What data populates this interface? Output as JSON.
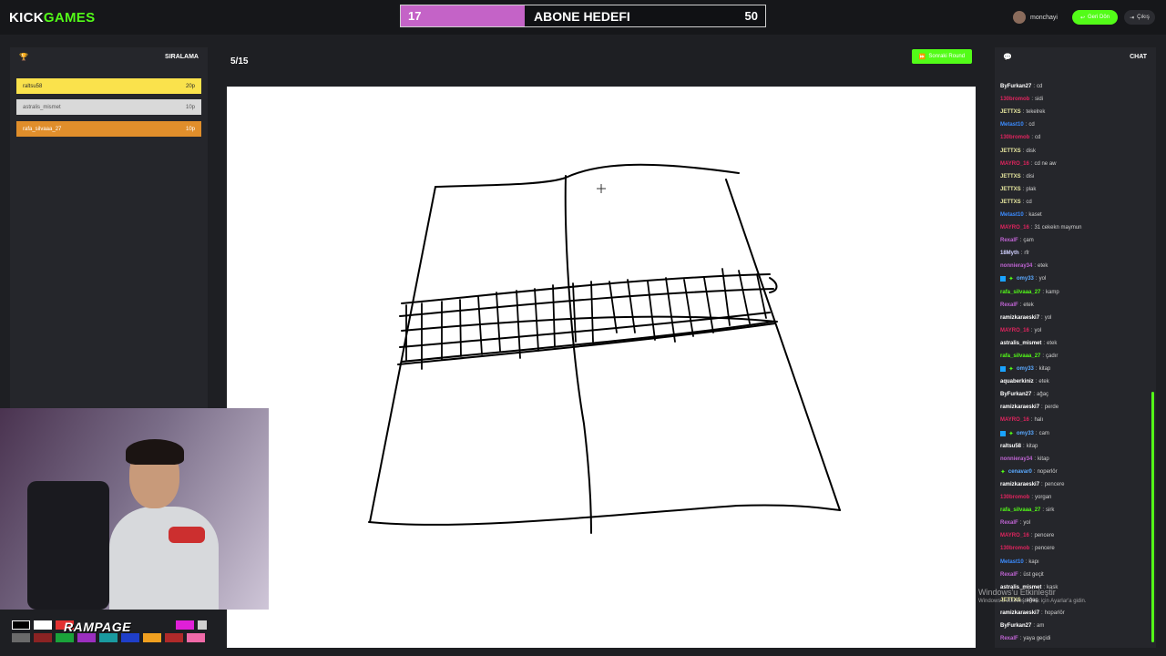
{
  "brand": {
    "left": "KICK",
    "right": "GAMES"
  },
  "subgoal": {
    "current": "17",
    "title": "ABONE HEDEFI",
    "goal": "50",
    "progress": 0.34
  },
  "header": {
    "username": "monchayi",
    "back_label": "Geri Dön",
    "exit_label": "Çıkış"
  },
  "leaderboard": {
    "title": "SIRALAMA",
    "rows": [
      {
        "name": "raltsu58",
        "score": "20p"
      },
      {
        "name": "astralis_mismet",
        "score": "10p"
      },
      {
        "name": "rafa_silvaaa_27",
        "score": "10p"
      }
    ]
  },
  "round": {
    "label": "5/15",
    "next_label": "Sonraki Round"
  },
  "toolbar": {
    "effect_text": "RAMPAGE"
  },
  "chat": {
    "title": "CHAT",
    "messages": [
      {
        "user": "ByFurkan27",
        "text": "cd",
        "color": "#ffffff"
      },
      {
        "user": "130bromob",
        "text": "sidi",
        "color": "#e0245e"
      },
      {
        "user": "JETTXS",
        "text": "tekelrek",
        "color": "#e8e8a0"
      },
      {
        "user": "Metast10",
        "text": "cd",
        "color": "#3b8cff"
      },
      {
        "user": "130bromob",
        "text": "cd",
        "color": "#e0245e"
      },
      {
        "user": "JETTXS",
        "text": "disk",
        "color": "#e8e8a0"
      },
      {
        "user": "MAYRO_16",
        "text": "cd ne aw",
        "color": "#e0245e"
      },
      {
        "user": "JETTXS",
        "text": "disi",
        "color": "#e8e8a0"
      },
      {
        "user": "JETTXS",
        "text": "plak",
        "color": "#e8e8a0"
      },
      {
        "user": "JETTXS",
        "text": "cd",
        "color": "#e8e8a0"
      },
      {
        "user": "Metast10",
        "text": "kaset",
        "color": "#3b8cff"
      },
      {
        "user": "MAYRO_16",
        "text": "31 cekekn maymun",
        "color": "#e0245e"
      },
      {
        "user": "RexalF",
        "text": "çam",
        "color": "#c064d4"
      },
      {
        "user": "18Myth",
        "text": "rfr",
        "color": "#d0d0ff"
      },
      {
        "user": "nonnieray34",
        "text": "etek",
        "color": "#c064d4"
      },
      {
        "user": "omy33",
        "text": "yol",
        "color": "#5aa9ff",
        "badge": true
      },
      {
        "user": "rafa_silvaaa_27",
        "text": "kamp",
        "color": "#53fc18"
      },
      {
        "user": "RexalF",
        "text": "etek",
        "color": "#c064d4"
      },
      {
        "user": "ramizkaraeski7",
        "text": "yol",
        "color": "#ffffff"
      },
      {
        "user": "MAYRO_16",
        "text": "yol",
        "color": "#e0245e"
      },
      {
        "user": "astralis_mismet",
        "text": "etek",
        "color": "#ffffff"
      },
      {
        "user": "rafa_silvaaa_27",
        "text": "çadır",
        "color": "#53fc18"
      },
      {
        "user": "omy33",
        "text": "kitap",
        "color": "#5aa9ff",
        "badge": true
      },
      {
        "user": "aquaberkiniz",
        "text": "etek",
        "color": "#ffffff"
      },
      {
        "user": "ByFurkan27",
        "text": "ağaç",
        "color": "#ffffff"
      },
      {
        "user": "ramizkaraeski7",
        "text": "perde",
        "color": "#ffffff"
      },
      {
        "user": "MAYRO_16",
        "text": "halı",
        "color": "#e0245e"
      },
      {
        "user": "omy33",
        "text": "cam",
        "color": "#5aa9ff",
        "badge": true
      },
      {
        "user": "raltsu58",
        "text": "kitap",
        "color": "#ffffff"
      },
      {
        "user": "nonnieray34",
        "text": "kitap",
        "color": "#c064d4"
      },
      {
        "user": "cenavar0",
        "text": "noperlör",
        "color": "#5aa9ff",
        "badge2": true
      },
      {
        "user": "ramizkaraeski7",
        "text": "pencere",
        "color": "#ffffff"
      },
      {
        "user": "130bromob",
        "text": "yorgan",
        "color": "#e0245e"
      },
      {
        "user": "rafa_silvaaa_27",
        "text": "sirk",
        "color": "#53fc18"
      },
      {
        "user": "RexalF",
        "text": "yol",
        "color": "#c064d4"
      },
      {
        "user": "MAYRO_16",
        "text": "pencere",
        "color": "#e0245e"
      },
      {
        "user": "130bromob",
        "text": "pencere",
        "color": "#e0245e"
      },
      {
        "user": "Metast10",
        "text": "kapı",
        "color": "#3b8cff"
      },
      {
        "user": "RexalF",
        "text": "üst geçit",
        "color": "#c064d4"
      },
      {
        "user": "astralis_mismet",
        "text": "kask",
        "color": "#ffffff"
      },
      {
        "user": "JETTXS",
        "text": "ağaç",
        "color": "#e8e8a0"
      },
      {
        "user": "ramizkaraeski7",
        "text": "hoparlör",
        "color": "#ffffff"
      },
      {
        "user": "ByFurkan27",
        "text": "am",
        "color": "#ffffff"
      },
      {
        "user": "RexalF",
        "text": "yaya geçidi",
        "color": "#c064d4"
      }
    ]
  },
  "watermark": {
    "line1": "Windows'u Etkinleştir",
    "line2": "Windows'u etkinleştirmek için Ayarlar'a gidin."
  },
  "colors": {
    "accent": "#53fc18",
    "sub_fill": "#c463c7",
    "panel": "#25262b",
    "bg": "#1e1f23"
  }
}
